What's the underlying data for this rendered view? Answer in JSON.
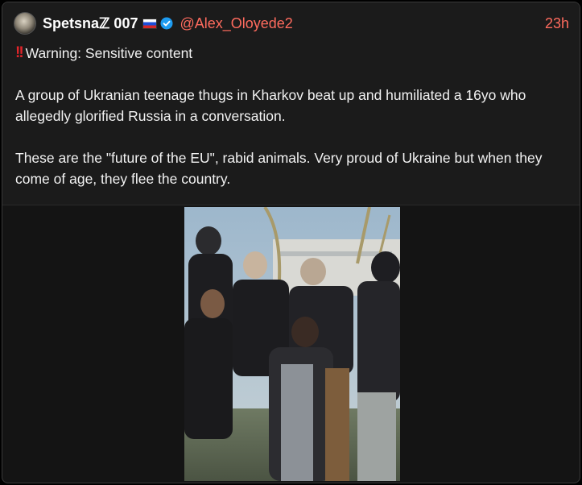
{
  "tweet": {
    "author_name": "Spetsnaℤ 007",
    "handle": "@Alex_Oloyede2",
    "time": "23h",
    "warning_icon": "double-exclamation-icon",
    "warning_text": "Warning: Sensitive content",
    "paragraph_1": "A group of Ukranian teenage thugs in Kharkov beat up and humiliated a 16yo who allegedly glorified Russia in a conversation.",
    "paragraph_2": "These are the \"future of the EU\", rabid animals. Very proud of Ukraine but when they come of age, they flee the country."
  },
  "colors": {
    "handle_accent": "#ff6b5e",
    "verified_badge": "#1d9bf0",
    "warning": "#e0242a"
  },
  "media": {
    "kind": "photo"
  }
}
